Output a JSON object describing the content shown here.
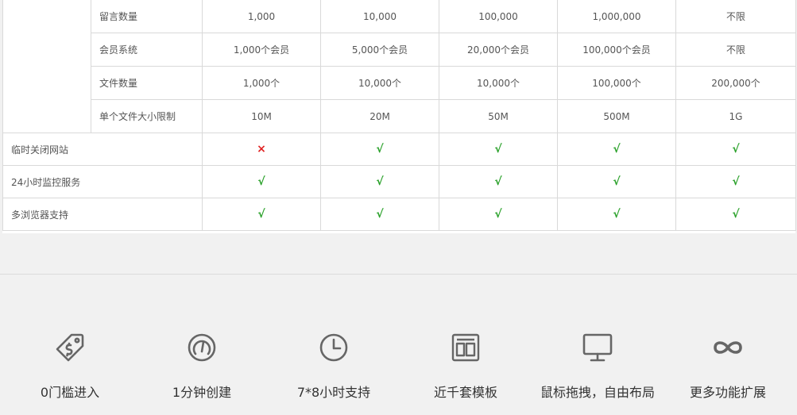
{
  "table": {
    "storage_rows": [
      {
        "label": "留言数量",
        "values": [
          "1,000",
          "10,000",
          "100,000",
          "1,000,000",
          "不限"
        ]
      },
      {
        "label": "会员系统",
        "values": [
          "1,000个会员",
          "5,000个会员",
          "20,000个会员",
          "100,000个会员",
          "不限"
        ]
      },
      {
        "label": "文件数量",
        "values": [
          "1,000个",
          "10,000个",
          "10,000个",
          "100,000个",
          "200,000个"
        ]
      },
      {
        "label": "单个文件大小限制",
        "values": [
          "10M",
          "20M",
          "50M",
          "500M",
          "1G"
        ]
      }
    ],
    "feature_rows": [
      {
        "label": "临时关闭网站",
        "marks": [
          "×",
          "√",
          "√",
          "√",
          "√"
        ]
      },
      {
        "label": "24小时监控服务",
        "marks": [
          "√",
          "√",
          "√",
          "√",
          "√"
        ]
      },
      {
        "label": "多浏览器支持",
        "marks": [
          "√",
          "√",
          "√",
          "√",
          "√"
        ]
      }
    ],
    "colors": {
      "yes": "#2aa12a",
      "no": "#e02323",
      "border": "#d9d9d9"
    }
  },
  "features": [
    {
      "label": "0门槛进入",
      "icon": "price-tag-icon"
    },
    {
      "label": "1分钟创建",
      "icon": "speedometer-icon"
    },
    {
      "label": "7*8小时支持",
      "icon": "clock-icon"
    },
    {
      "label": "近千套模板",
      "icon": "template-layout-icon"
    },
    {
      "label": "鼠标拖拽，自由布局",
      "icon": "monitor-icon"
    },
    {
      "label": "更多功能扩展",
      "icon": "infinity-icon"
    }
  ]
}
